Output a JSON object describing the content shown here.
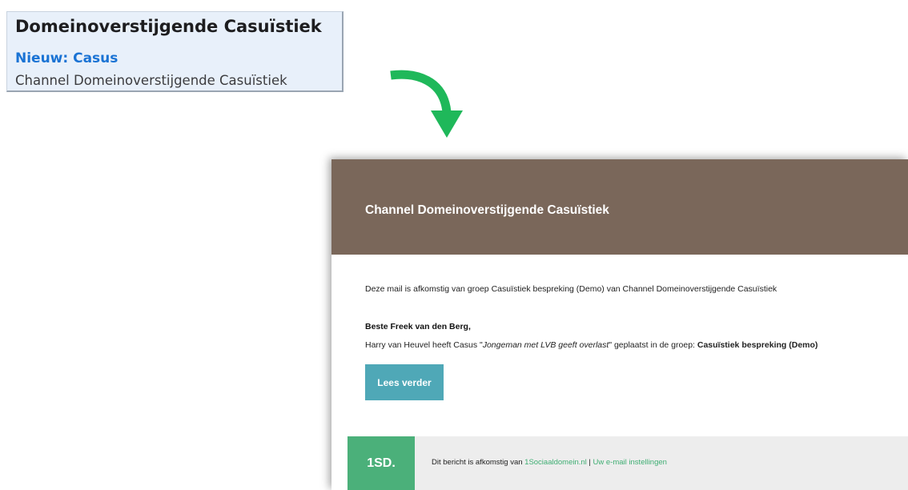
{
  "notification": {
    "title": "Domeinoverstijgende Casuïstiek",
    "subtitle": "Nieuw: Casus",
    "source": "Channel Domeinoverstijgende Casuïstiek"
  },
  "email": {
    "header_title": "Channel Domeinoverstijgende Casuïstiek",
    "intro": "Deze mail is afkomstig van groep Casuïstiek bespreking (Demo) van Channel Domeinoverstijgende Casuïstiek",
    "greeting": "Beste Freek van den Berg,",
    "body": {
      "prefix": "Harry van Heuvel heeft Casus \"",
      "case_title": "Jongeman met LVB geeft overlast",
      "middle": "\" geplaatst in de groep: ",
      "group": "Casuïstiek bespreking (Demo)"
    },
    "button_label": "Lees verder",
    "footer": {
      "logo": "1SD.",
      "prefix": "Dit bericht is afkomstig van ",
      "site_link": "1Sociaaldomein.nl",
      "separator": " | ",
      "settings_link": "Uw e-mail instellingen"
    }
  },
  "colors": {
    "header_bg": "#7a675a",
    "button_bg": "#4fa8b7",
    "logo_bg": "#4bb07a",
    "arrow": "#1fb85a",
    "notif_link": "#1a73d4"
  }
}
